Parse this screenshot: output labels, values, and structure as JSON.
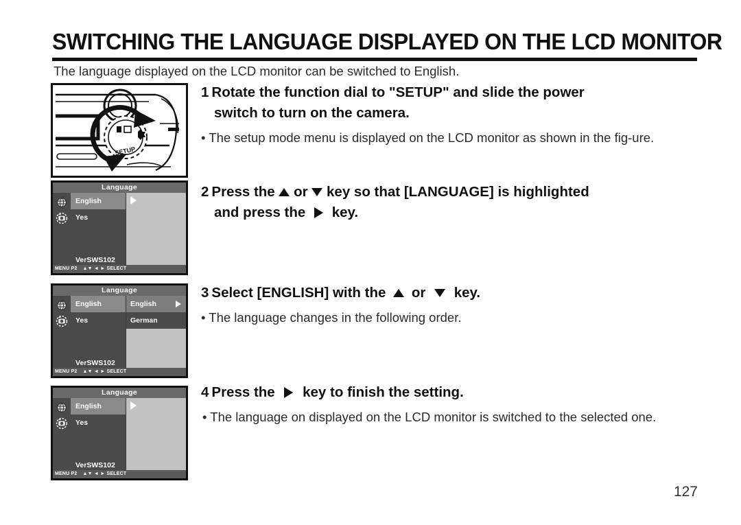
{
  "page": {
    "title": "SWITCHING THE LANGUAGE DISPLAYED ON THE LCD MONITOR",
    "intro": "The language displayed on the LCD monitor can be switched to  English.",
    "page_number": "127"
  },
  "figures": {
    "camera": {
      "caption": "camera function dial set to SETUP",
      "dial_label": "SETUP"
    },
    "lcd_common": {
      "screen_title": "Language",
      "menu_items": [
        "English",
        "Yes"
      ],
      "version": "VerSWS102",
      "status_left": "MENU P2",
      "status_keys": "▲▼ ◄ ►",
      "status_right": "SELECT"
    },
    "lcd1": {
      "selected_item": "English",
      "submenu": []
    },
    "lcd2": {
      "selected_item": "English",
      "submenu": [
        "English",
        "German"
      ],
      "submenu_selected": "English"
    },
    "lcd3": {
      "selected_item": "English",
      "submenu": []
    }
  },
  "steps": [
    {
      "number": "1",
      "head_part1": "Rotate the function dial to \"SETUP\" and slide the power",
      "head_part2": "switch  to  turn on the camera.",
      "bullet": "• The setup mode menu is displayed on the LCD monitor as shown in the fig-ure."
    },
    {
      "number": "2",
      "head_a": "Press the",
      "head_b": "or",
      "head_c": "key so that [LANGUAGE] is highlighted",
      "head_d": "and press the",
      "head_e": "key.",
      "bullet": ""
    },
    {
      "number": "3",
      "head_a": "Select [ENGLISH] with the",
      "head_b": "or",
      "head_c": "key.",
      "bullet": "• The language changes in the following order."
    },
    {
      "number": "4",
      "head_a": "Press the",
      "head_b": "key to finish the setting.",
      "bullet": "• The language on displayed on the LCD monitor is switched to the selected one."
    }
  ],
  "colors": {
    "text": "#111111",
    "lcd_background": "#6e6e6e",
    "lcd_panel": "#4a4a4a",
    "lcd_highlight": "#8a8a8a",
    "lcd_right_panel": "#c2c2c2",
    "lcd_status_bar": "#5a5a5a"
  }
}
